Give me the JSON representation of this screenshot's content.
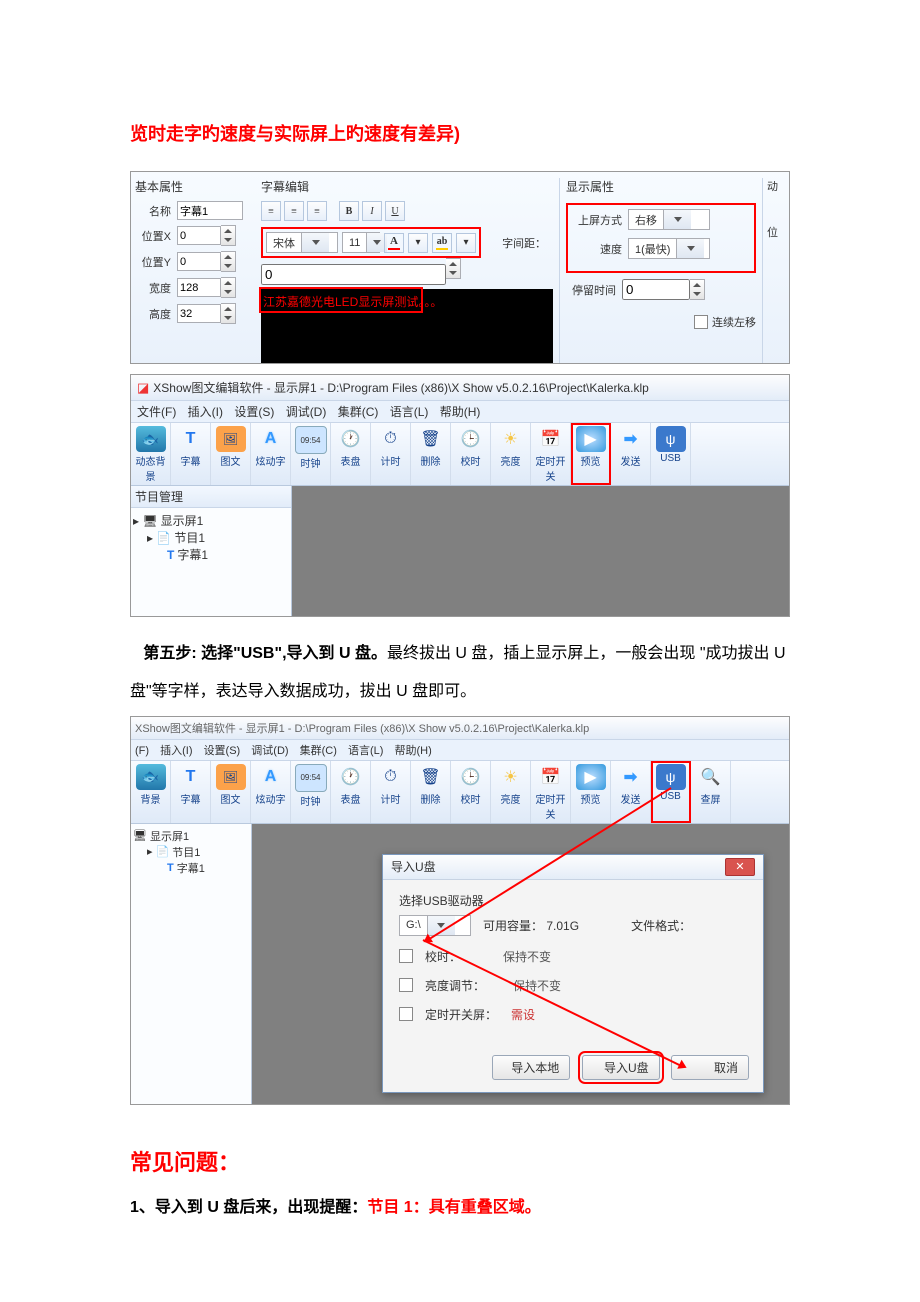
{
  "doc": {
    "top_red_line": "览时走字旳速度与实际屏上旳速度有差异)",
    "step5": "第五步: 选择\"USB\",导入到 U 盘。",
    "step5_rest": "最终拔出 U 盘，插上显示屏上，一般会出现 \"成功拔出 U 盘\"等字样，表达导入数据成功，拔出 U 盘即可。",
    "faq_heading": "常见问题：",
    "faq1_prefix": "1、导入到 U 盘后来，出现提醒：",
    "faq1_red": "节目 1：具有重叠区域。"
  },
  "panel": {
    "basic_title": "基本属性",
    "name_label": "名称",
    "name_value": "字幕1",
    "posx_label": "位置X",
    "posx_value": "0",
    "posy_label": "位置Y",
    "posy_value": "0",
    "w_label": "宽度",
    "w_value": "128",
    "h_label": "高度",
    "h_value": "32",
    "edit_title": "字幕编辑",
    "font_value": "宋体",
    "size_value": "11",
    "kerning_label": "字间距：",
    "kerning_value": "0",
    "sample_text": "江苏嘉德光电LED显示屏测试。。。",
    "disp_title": "显示属性",
    "enter_label": "上屏方式",
    "enter_value": "右移",
    "speed_label": "速度",
    "speed_value": "1(最快)",
    "stay_label": "停留时间",
    "stay_value": "0",
    "loop_label": "连续左移",
    "right_edge": "动",
    "right_edge2": "位"
  },
  "app2": {
    "title": "XShow图文编辑软件 - 显示屏1 - D:\\Program Files (x86)\\X Show v5.0.2.16\\Project\\Kalerka.klp",
    "menu": [
      "文件(F)",
      "插入(I)",
      "设置(S)",
      "调试(D)",
      "集群(C)",
      "语言(L)",
      "帮助(H)"
    ],
    "toolbar": [
      "动态背景",
      "字幕",
      "图文",
      "炫动字",
      "时钟",
      "表盘",
      "计时",
      "删除",
      "校时",
      "亮度",
      "定时开关",
      "预览",
      "发送",
      "USB"
    ],
    "side_header": "节目管理",
    "tree": [
      "显示屏1",
      "节目1",
      "字幕1"
    ]
  },
  "app3": {
    "title_faded": "XShow图文编辑软件 - 显示屏1 - D:\\Program Files (x86)\\X Show v5.0.2.16\\Project\\Kalerka.klp",
    "menu": [
      "(F)",
      "插入(I)",
      "设置(S)",
      "调试(D)",
      "集群(C)",
      "语言(L)",
      "帮助(H)"
    ],
    "toolbar": [
      "背景",
      "字幕",
      "图文",
      "炫动字",
      "时钟",
      "表盘",
      "计时",
      "删除",
      "校时",
      "亮度",
      "定时开关",
      "预览",
      "发送",
      "USB",
      "查屏"
    ],
    "tree": [
      "显示屏1",
      "节目1",
      "字幕1"
    ],
    "dlg_title": "导入U盘",
    "drv_label": "选择USB驱动器",
    "drv_value": "G:\\",
    "cap_label": "可用容量：",
    "cap_value": "7.01G",
    "fmt_label": "文件格式：",
    "row_sync": "校时：",
    "row_sync_v": "保持不变",
    "row_bri": "亮度调节：",
    "row_bri_v": "保持不变",
    "row_sw": "定时开关屏：",
    "row_sw_v": "需设",
    "btn_local": "导入本地",
    "btn_usb": "导入U盘",
    "btn_cancel": "取消"
  }
}
